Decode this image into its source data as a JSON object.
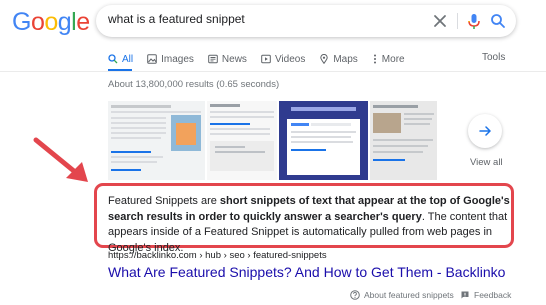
{
  "logo": {
    "letters": [
      "G",
      "o",
      "o",
      "g",
      "l",
      "e"
    ],
    "colors": [
      "#4285F4",
      "#EA4335",
      "#FBBC05",
      "#4285F4",
      "#34A853",
      "#EA4335"
    ]
  },
  "search": {
    "query": "what is a featured snippet"
  },
  "tabs": [
    {
      "label": "All",
      "active": true
    },
    {
      "label": "Images"
    },
    {
      "label": "News"
    },
    {
      "label": "Videos"
    },
    {
      "label": "Maps"
    },
    {
      "label": "More"
    }
  ],
  "tools_label": "Tools",
  "result_stats": "About 13,800,000 results (0.65 seconds)",
  "view_all_label": "View all",
  "snippet": {
    "prefix": "Featured Snippets are ",
    "bold": "short snippets of text that appear at the top of Google's search results in order to quickly answer a searcher's query",
    "suffix": ". The content that appears inside of a Featured Snippet is automatically pulled from web pages in Google's index."
  },
  "result": {
    "url": "https://backlinko.com › hub › seo › featured-snippets",
    "title": "What Are Featured Snippets? And How to Get Them - Backlinko"
  },
  "footer": {
    "about": "About featured snippets",
    "feedback": "Feedback"
  },
  "colors": {
    "accent": "#1a73e8",
    "highlight_border": "#e3464d",
    "link": "#1a0dab"
  }
}
